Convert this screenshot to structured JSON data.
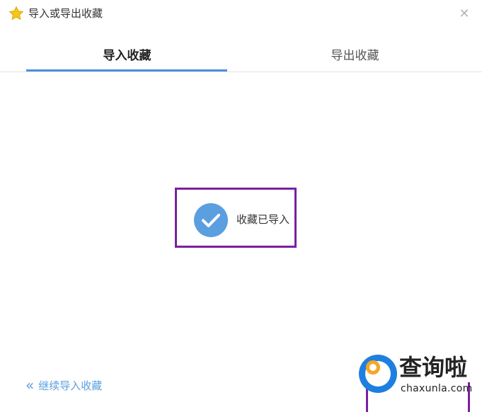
{
  "window": {
    "title": "导入或导出收藏",
    "title_icon": "star-icon",
    "close_glyph": "✕"
  },
  "tabs": [
    {
      "label": "导入收藏",
      "active": true
    },
    {
      "label": "导出收藏",
      "active": false
    }
  ],
  "result": {
    "icon": "check-circle-icon",
    "message": "收藏已导入"
  },
  "footer": {
    "continue_icon": "double-chevron-left-icon",
    "continue_glyph": "«",
    "continue_label": "继续导入收藏"
  },
  "watermark": {
    "brand": "查询啦",
    "domain": "chaxunla.com"
  },
  "colors": {
    "accent": "#4a90e2",
    "check_fill": "#5b9fe0",
    "highlight": "#7a1fa2",
    "star": "#f5c518"
  }
}
